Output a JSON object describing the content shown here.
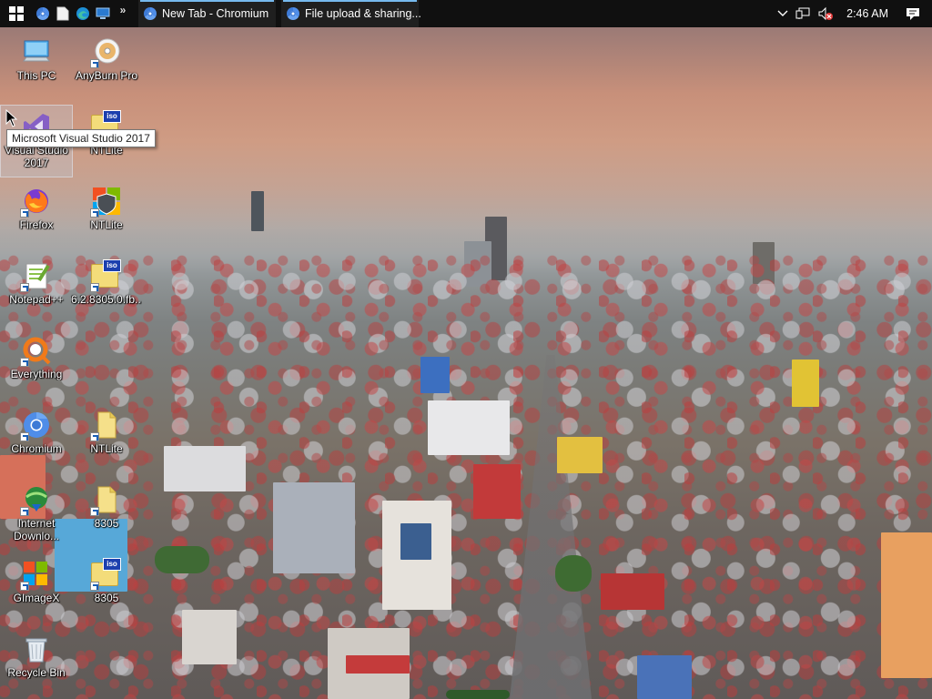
{
  "taskbar": {
    "start_icon": "windows-start-icon",
    "pinned": [
      "chromium-icon",
      "file-icon",
      "edge-icon",
      "monitor-icon"
    ],
    "overflow": "»",
    "tasks": [
      {
        "label": "New Tab - Chromium",
        "icon": "chromium-icon"
      },
      {
        "label": "File upload & sharing...",
        "icon": "chromium-icon"
      }
    ],
    "tray": {
      "icons": [
        "chevron-up-icon",
        "network-icon",
        "volume-muted-icon"
      ],
      "clock": "2:46 AM",
      "notification_icon": "action-center-icon"
    }
  },
  "desktop": {
    "icons": [
      {
        "label": "This PC",
        "icon": "computer-icon"
      },
      {
        "label": "AnyBurn Pro",
        "icon": "disc-icon"
      },
      {
        "label": "Visual Studio 2017",
        "icon": "visual-studio-icon"
      },
      {
        "label": "NTLite",
        "icon": "iso-file-icon"
      },
      {
        "label": "Firefox",
        "icon": "firefox-icon"
      },
      {
        "label": "NTLite",
        "icon": "ntlite-shield-icon"
      },
      {
        "label": "Notepad++",
        "icon": "notepad-plus-plus-icon"
      },
      {
        "label": "6.2.8305.0.fb...",
        "icon": "iso-file-icon"
      },
      {
        "label": "Everything",
        "icon": "everything-icon"
      },
      {
        "label": "Chromium",
        "icon": "chromium-icon"
      },
      {
        "label": "NTLite",
        "icon": "file-icon"
      },
      {
        "label": "Internet Downlo...",
        "icon": "internet-download-icon"
      },
      {
        "label": "8305",
        "icon": "file-icon"
      },
      {
        "label": "GImageX",
        "icon": "gimagex-icon"
      },
      {
        "label": "8305",
        "icon": "iso-file-icon"
      },
      {
        "label": "Recycle Bin",
        "icon": "recycle-bin-icon"
      }
    ],
    "iso_tag": "iso",
    "tooltip": "Microsoft Visual Studio 2017"
  }
}
